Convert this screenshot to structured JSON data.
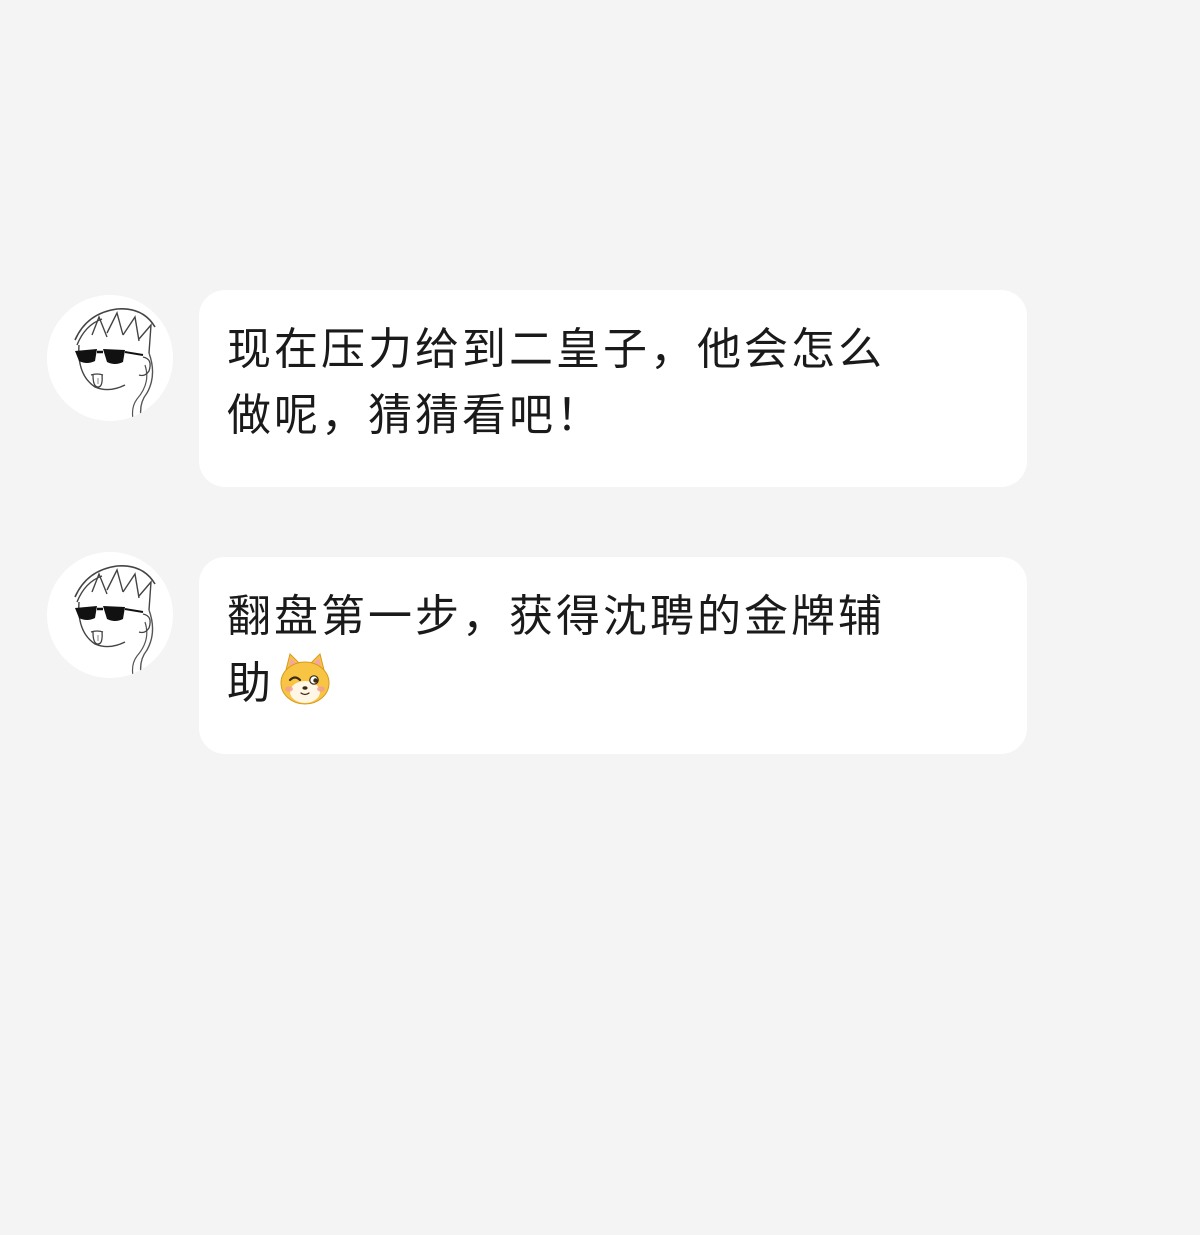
{
  "messages": [
    {
      "avatar_icon": "sunglasses-boy-avatar-icon",
      "lines": [
        "现在压力给到二皇子，他会怎么",
        "做呢，猜猜看吧！"
      ]
    },
    {
      "avatar_icon": "sunglasses-boy-avatar-icon",
      "lines": [
        "翻盘第一步，获得沈聘的金牌辅",
        "助"
      ],
      "emoji_icon": "shiba-dog-emoji-icon"
    }
  ],
  "colors": {
    "background": "#f4f4f4",
    "bubble": "#ffffff",
    "text": "#1a1a1a",
    "emoji_fill": "#f7c443"
  }
}
